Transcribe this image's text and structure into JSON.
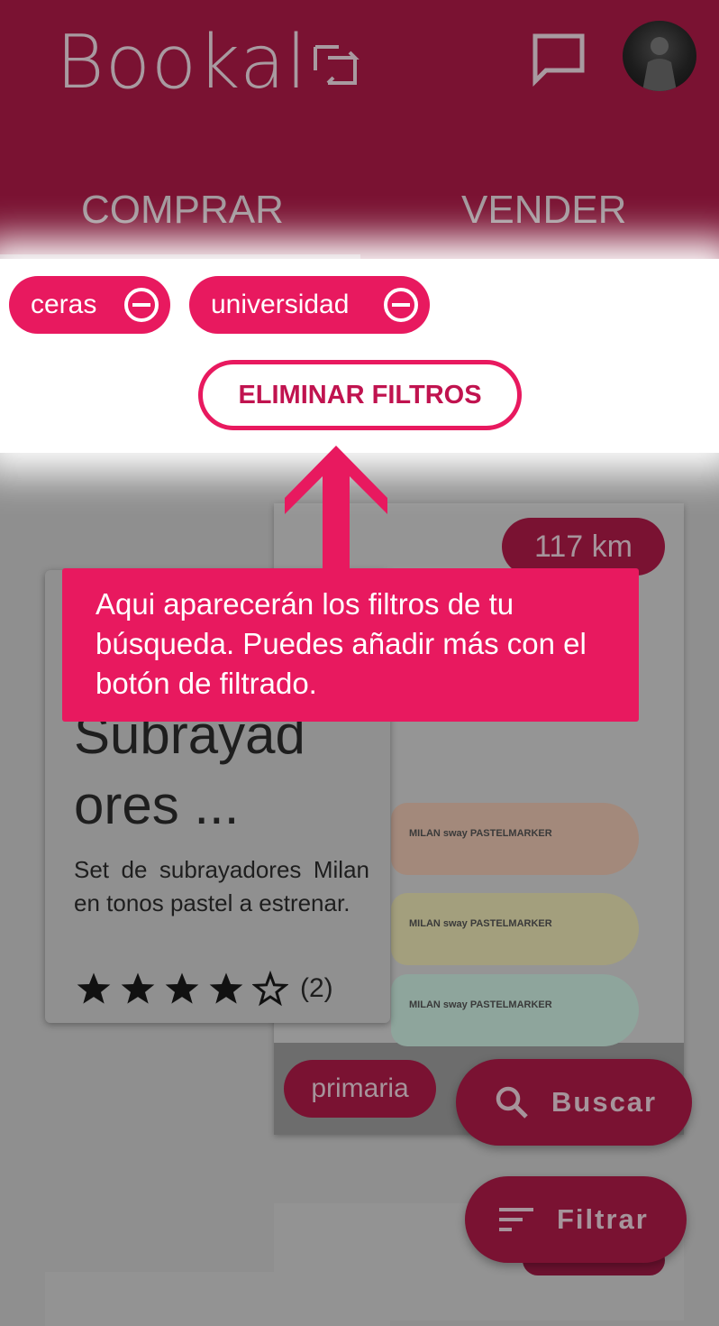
{
  "app": {
    "logo_text": "Bookal",
    "logo_icon": "swap-arrows-icon",
    "chat_icon": "chat-bubble-icon",
    "avatar_icon": "user-avatar"
  },
  "tabs": [
    {
      "label": "COMPRAR",
      "selected": true
    },
    {
      "label": "VENDER",
      "selected": false
    }
  ],
  "filters": {
    "chips": [
      {
        "label": "ceras",
        "remove_icon": "minus-circle-icon"
      },
      {
        "label": "universidad",
        "remove_icon": "minus-circle-icon"
      }
    ],
    "clear_label": "ELIMINAR FILTROS"
  },
  "tooltip": {
    "text": "Aqui aparecerán los filtros de tu búsqueda. Puedes añadir más con el botón de filtrado."
  },
  "listing": {
    "title": "Subrayad ores ...",
    "description": "Set de subrayadores Milan en tonos pastel a estrenar.",
    "rating": 4,
    "rating_max": 5,
    "rating_count": "(2)",
    "distance": "117 km",
    "category_tag": "primaria",
    "product_print": "MILAN sway PASTELMARKER"
  },
  "actions": {
    "search_label": "Buscar",
    "filter_label": "Filtrar"
  },
  "colors": {
    "brand": "#e8195f",
    "brand_dimmed": "#7a1232",
    "overlay_gray": "#8f8f8f"
  }
}
